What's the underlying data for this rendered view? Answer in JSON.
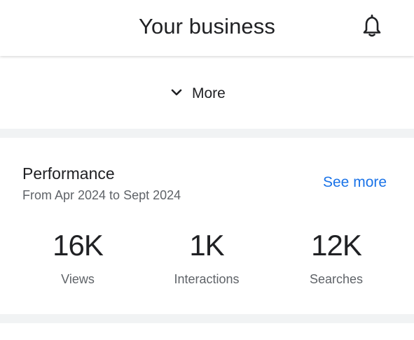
{
  "header": {
    "title": "Your business",
    "notifications_icon": "bell-icon"
  },
  "more": {
    "label": "More",
    "icon": "chevron-down-icon"
  },
  "performance": {
    "title": "Performance",
    "date_range": "From Apr 2024 to Sept 2024",
    "see_more_label": "See more",
    "link_color": "#1a73e8",
    "stats": [
      {
        "value": "16K",
        "label": "Views"
      },
      {
        "value": "1K",
        "label": "Interactions"
      },
      {
        "value": "12K",
        "label": "Searches"
      }
    ]
  }
}
